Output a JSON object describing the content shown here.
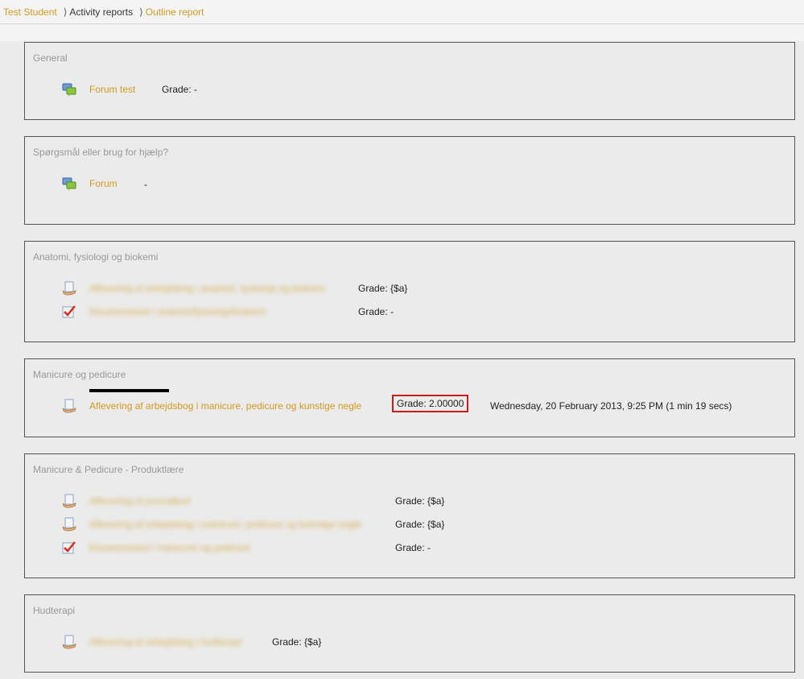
{
  "breadcrumb": {
    "user": "Test Student",
    "sep": "⟩",
    "reports": "Activity reports",
    "outline": "Outline report"
  },
  "sections": [
    {
      "title": "General",
      "items": [
        {
          "icon": "forum-icon",
          "name": "Forum test",
          "grade": "Grade: -"
        }
      ]
    },
    {
      "title": "Spørgsmål eller brug for hjælp?",
      "items": [
        {
          "icon": "forum-icon",
          "name": "Forum",
          "grade": "-"
        }
      ]
    },
    {
      "title": "Anatomi, fysiologi og biokemi",
      "items": [
        {
          "icon": "assignment-icon",
          "name": "Aflevering af arbejdsbog i anatomi, fysiologi og biokemi",
          "grade": "Grade: {$a}"
        },
        {
          "icon": "quiz-icon",
          "name": "Eksamenstest i anatomi/fysiologi/biokemi",
          "grade": "Grade: -"
        }
      ]
    },
    {
      "title": "Manicure og pedicure",
      "items": [
        {
          "icon": "assignment-icon",
          "name": "Aflevering af arbejdsbog i manicure, pedicure og kunstige negle",
          "grade": "Grade: 2.00000",
          "time": "Wednesday, 20 February 2013, 9:25 PM (1 min 19 secs)"
        }
      ]
    },
    {
      "title": "Manicure & Pedicure - Produktlære",
      "items": [
        {
          "icon": "assignment-icon",
          "name": "Aflevering af journalkort",
          "grade": "Grade: {$a}"
        },
        {
          "icon": "assignment-icon",
          "name": "Aflevering af arbejdsbog i manicure, pedicure og kunstige negle",
          "grade": "Grade: {$a}"
        },
        {
          "icon": "quiz-icon",
          "name": "Eksamenstest i manicure og pedicure",
          "grade": "Grade: -"
        }
      ]
    },
    {
      "title": "Hudterapi",
      "items": [
        {
          "icon": "assignment-icon",
          "name": "Aflevering af arbejdsbog i hudterapi",
          "grade": "Grade: {$a}"
        }
      ]
    }
  ],
  "colors": {
    "link": "#d19a1f",
    "highlight_border": "#c81c1c",
    "section_border": "#555555",
    "background": "#ebebeb"
  }
}
